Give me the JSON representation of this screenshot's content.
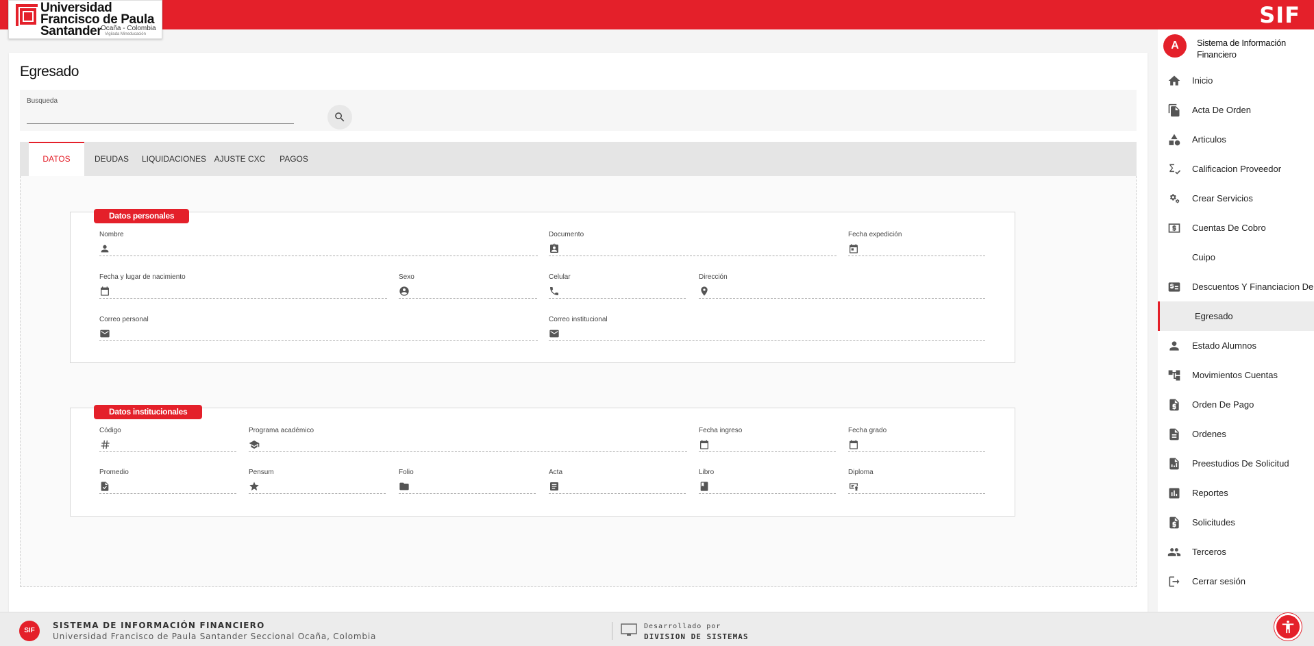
{
  "header": {
    "app_logo": "SIF",
    "university_name": "Universidad Francisco de Paula Santander",
    "university_city": "Ocaña - Colombia",
    "university_tag": "Vigilada Mineducación"
  },
  "page": {
    "title": "Egresado",
    "search": {
      "label": "Busqueda",
      "value": "",
      "button_icon": "search-icon"
    },
    "tabs": [
      {
        "label": "DATOS",
        "active": true
      },
      {
        "label": "DEUDAS",
        "active": false
      },
      {
        "label": "LIQUIDACIONES",
        "active": false
      },
      {
        "label": "AJUSTE CXC",
        "active": false
      },
      {
        "label": "PAGOS",
        "active": false
      }
    ]
  },
  "datos_personales": {
    "title": "Datos personales",
    "fields": {
      "nombre": {
        "label": "Nombre",
        "icon": "person-icon",
        "value": ""
      },
      "documento": {
        "label": "Documento",
        "icon": "id-card-icon",
        "value": ""
      },
      "fecha_expedicion": {
        "label": "Fecha expedición",
        "icon": "calendar-icon",
        "value": ""
      },
      "fecha_nacimiento": {
        "label": "Fecha y lugar de nacimiento",
        "icon": "calendar-icon",
        "value": ""
      },
      "sexo": {
        "label": "Sexo",
        "icon": "account-circle-icon",
        "value": ""
      },
      "celular": {
        "label": "Celular",
        "icon": "phone-icon",
        "value": ""
      },
      "direccion": {
        "label": "Dirección",
        "icon": "location-pin-icon",
        "value": ""
      },
      "correo_personal": {
        "label": "Correo personal",
        "icon": "mail-icon",
        "value": ""
      },
      "correo_institucional": {
        "label": "Correo institucional",
        "icon": "mail-icon",
        "value": ""
      }
    }
  },
  "datos_institucionales": {
    "title": "Datos institucionales",
    "fields": {
      "codigo": {
        "label": "Código",
        "icon": "hash-icon",
        "value": ""
      },
      "programa": {
        "label": "Programa académico",
        "icon": "graduation-cap-icon",
        "value": ""
      },
      "fecha_ingreso": {
        "label": "Fecha ingreso",
        "icon": "calendar-icon",
        "value": ""
      },
      "fecha_grado": {
        "label": "Fecha grado",
        "icon": "calendar-icon",
        "value": ""
      },
      "promedio": {
        "label": "Promedio",
        "icon": "grade-document-icon",
        "value": ""
      },
      "pensum": {
        "label": "Pensum",
        "icon": "star-icon",
        "value": ""
      },
      "folio": {
        "label": "Folio",
        "icon": "folder-icon",
        "value": ""
      },
      "acta": {
        "label": "Acta",
        "icon": "document-icon",
        "value": ""
      },
      "libro": {
        "label": "Libro",
        "icon": "book-icon",
        "value": ""
      },
      "diploma": {
        "label": "Diploma",
        "icon": "diploma-icon",
        "value": ""
      }
    }
  },
  "sidebar": {
    "avatar_letter": "A",
    "title": "Sistema de Información Financiero",
    "items": [
      {
        "label": "Inicio",
        "icon": "home-icon"
      },
      {
        "label": "Acta De Orden",
        "icon": "file-copy-icon"
      },
      {
        "label": "Articulos",
        "icon": "category-icon"
      },
      {
        "label": "Calificacion Proveedor",
        "icon": "rating-check-icon"
      },
      {
        "label": "Crear Servicios",
        "icon": "settings-cogs-icon"
      },
      {
        "label": "Cuentas De Cobro",
        "icon": "money-icon"
      },
      {
        "label": "Cuipo",
        "icon": ""
      },
      {
        "label": "Descuentos Y Financiacion De",
        "icon": "price-list-icon"
      },
      {
        "label": "Egresado",
        "icon": "",
        "active": true
      },
      {
        "label": "Estado Alumnos",
        "icon": "person-icon"
      },
      {
        "label": "Movimientos Cuentas",
        "icon": "account-tree-icon"
      },
      {
        "label": "Orden De Pago",
        "icon": "dollar-document-icon"
      },
      {
        "label": "Ordenes",
        "icon": "document-icon"
      },
      {
        "label": "Preestudios De Solicitud",
        "icon": "chart-document-icon"
      },
      {
        "label": "Reportes",
        "icon": "bar-chart-icon"
      },
      {
        "label": "Solicitudes",
        "icon": "dollar-document-icon"
      },
      {
        "label": "Terceros",
        "icon": "people-icon"
      },
      {
        "label": "Cerrar sesión",
        "icon": "logout-icon"
      }
    ]
  },
  "footer": {
    "logo": "SIF",
    "title": "SISTEMA DE INFORMACIÓN FINANCIERO",
    "subtitle": "Universidad Francisco de Paula Santander Seccional Ocaña, Colombia",
    "dev_label": "Desarrollado por",
    "dev_name": "DIVISION DE SISTEMAS"
  },
  "colors": {
    "primary": "#e4202a",
    "icon": "#555555"
  }
}
